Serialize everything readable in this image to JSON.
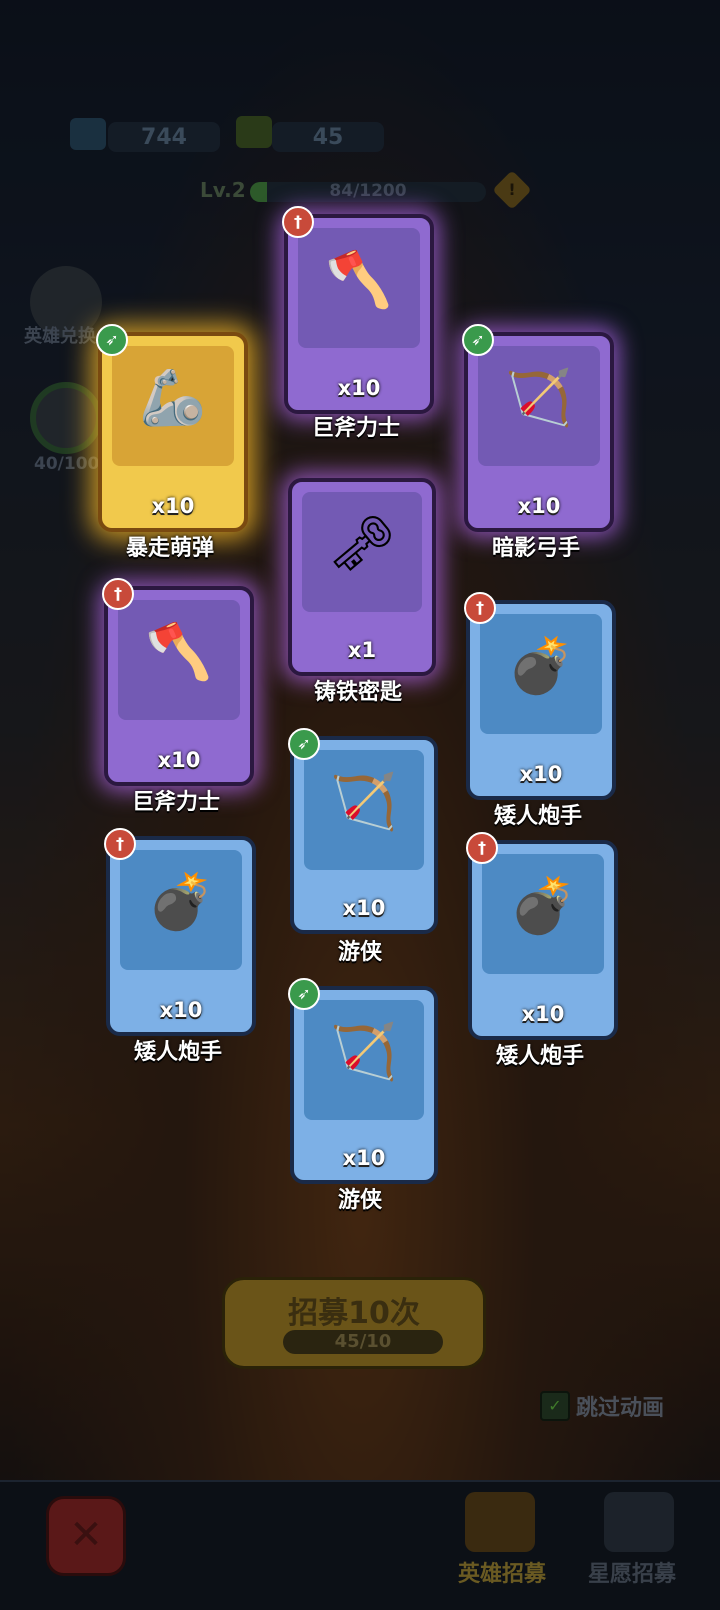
{
  "resources": {
    "gems": "744",
    "tickets": "45"
  },
  "level": {
    "label": "Lv.2",
    "xp_text": "84/1200",
    "xp_fraction": 0.07
  },
  "side": {
    "hero_exchange": "英雄兑换",
    "progress": "40/100"
  },
  "cards": [
    {
      "name": "巨斧力士",
      "qty": "x10",
      "rarity": "purple",
      "class": "red",
      "class_icon": "sword-icon",
      "figure": "🪓"
    },
    {
      "name": "暴走萌弹",
      "qty": "x10",
      "rarity": "gold",
      "class": "green",
      "class_icon": "bow-icon",
      "figure": "🦾"
    },
    {
      "name": "暗影弓手",
      "qty": "x10",
      "rarity": "purple",
      "class": "green",
      "class_icon": "bow-icon",
      "figure": "🏹"
    },
    {
      "name": "铸铁密匙",
      "qty": "x1",
      "rarity": "purple",
      "class": "",
      "class_icon": "",
      "figure": "🗝"
    },
    {
      "name": "巨斧力士",
      "qty": "x10",
      "rarity": "purple",
      "class": "red",
      "class_icon": "sword-icon",
      "figure": "🪓"
    },
    {
      "name": "矮人炮手",
      "qty": "x10",
      "rarity": "blue",
      "class": "red",
      "class_icon": "sword-icon",
      "figure": "💣"
    },
    {
      "name": "游侠",
      "qty": "x10",
      "rarity": "blue",
      "class": "green",
      "class_icon": "bow-icon",
      "figure": "🏹"
    },
    {
      "name": "矮人炮手",
      "qty": "x10",
      "rarity": "blue",
      "class": "red",
      "class_icon": "sword-icon",
      "figure": "💣"
    },
    {
      "name": "矮人炮手",
      "qty": "x10",
      "rarity": "blue",
      "class": "red",
      "class_icon": "sword-icon",
      "figure": "💣"
    },
    {
      "name": "游侠",
      "qty": "x10",
      "rarity": "blue",
      "class": "green",
      "class_icon": "bow-icon",
      "figure": "🏹"
    }
  ],
  "recruit": {
    "label": "招募10次",
    "count": "45/10"
  },
  "skip": {
    "label": "跳过动画",
    "checked": true
  },
  "tabs": {
    "hero": "英雄招募",
    "star": "星愿招募"
  }
}
